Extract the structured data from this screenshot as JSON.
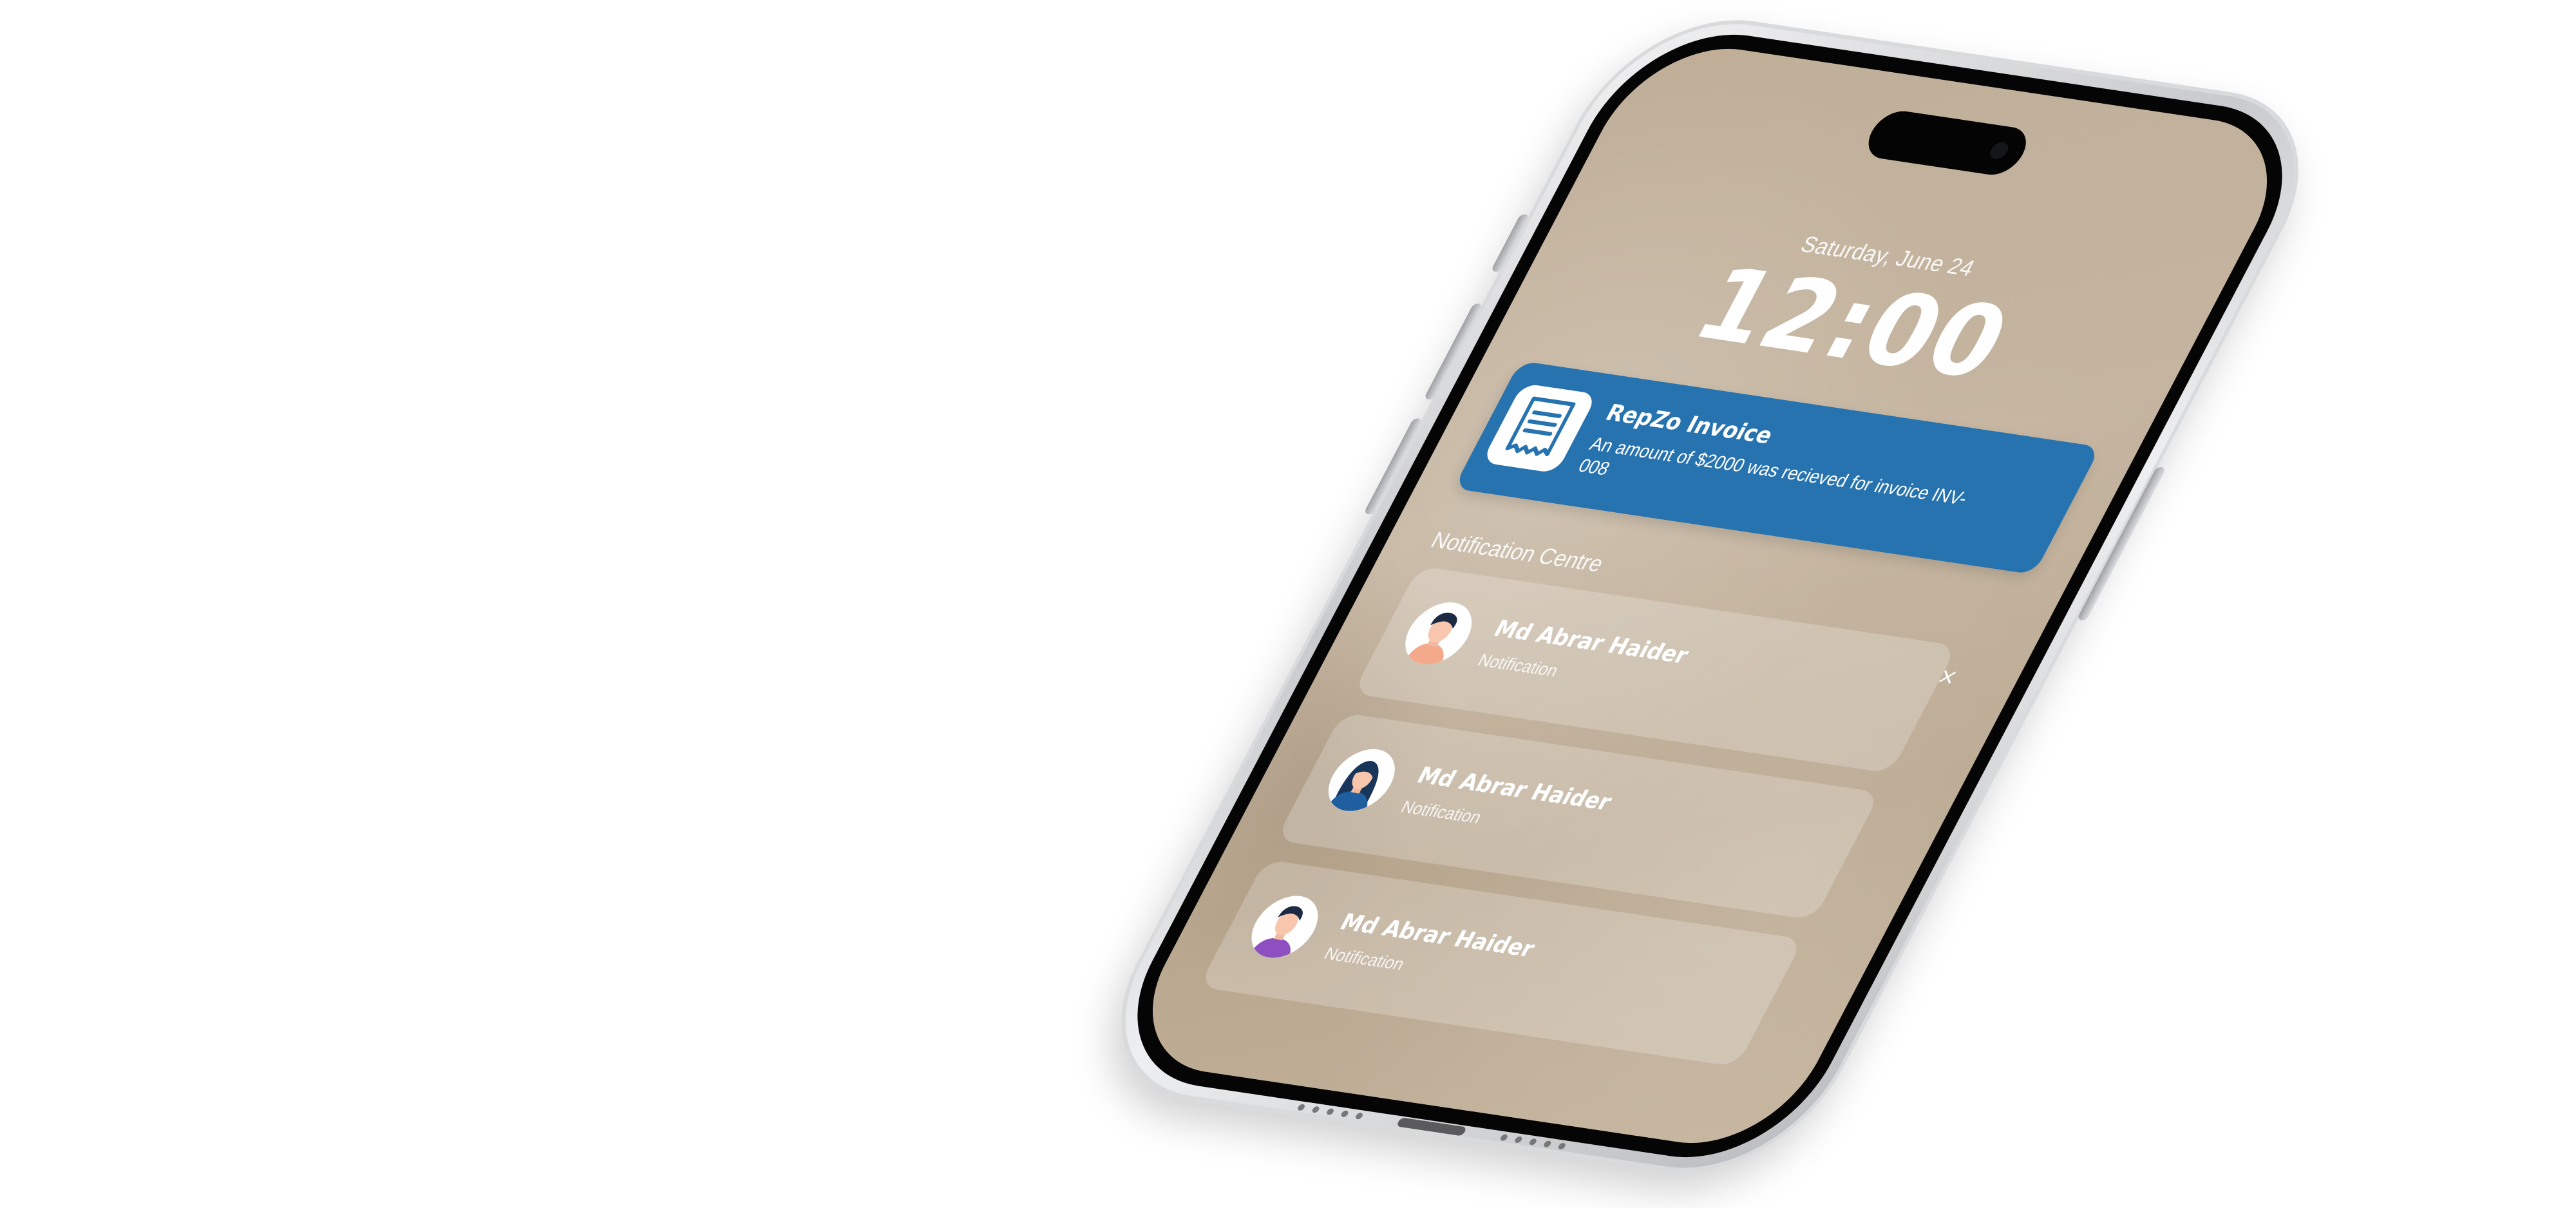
{
  "lock_screen": {
    "date": "Saturday, June 24",
    "time": "12:00"
  },
  "banner": {
    "title": "RepZo Invoice",
    "body": "An amount of $2000 was recieved for invoice INV-008",
    "icon": "invoice-receipt-icon",
    "color": "#2673b0"
  },
  "notification_centre": {
    "heading": "Notification Centre",
    "close_glyph": "×",
    "items": [
      {
        "name": "Md Abrar Haider",
        "subtitle": "Notification",
        "avatar": "avatar-man-orange"
      },
      {
        "name": "Md Abrar Haider",
        "subtitle": "Notification",
        "avatar": "avatar-woman-blue"
      },
      {
        "name": "Md Abrar Haider",
        "subtitle": "Notification",
        "avatar": "avatar-man-purple"
      }
    ]
  },
  "colors": {
    "wallpaper": "#bfae98",
    "frame": "#c9cacd",
    "bezel": "#050505"
  }
}
